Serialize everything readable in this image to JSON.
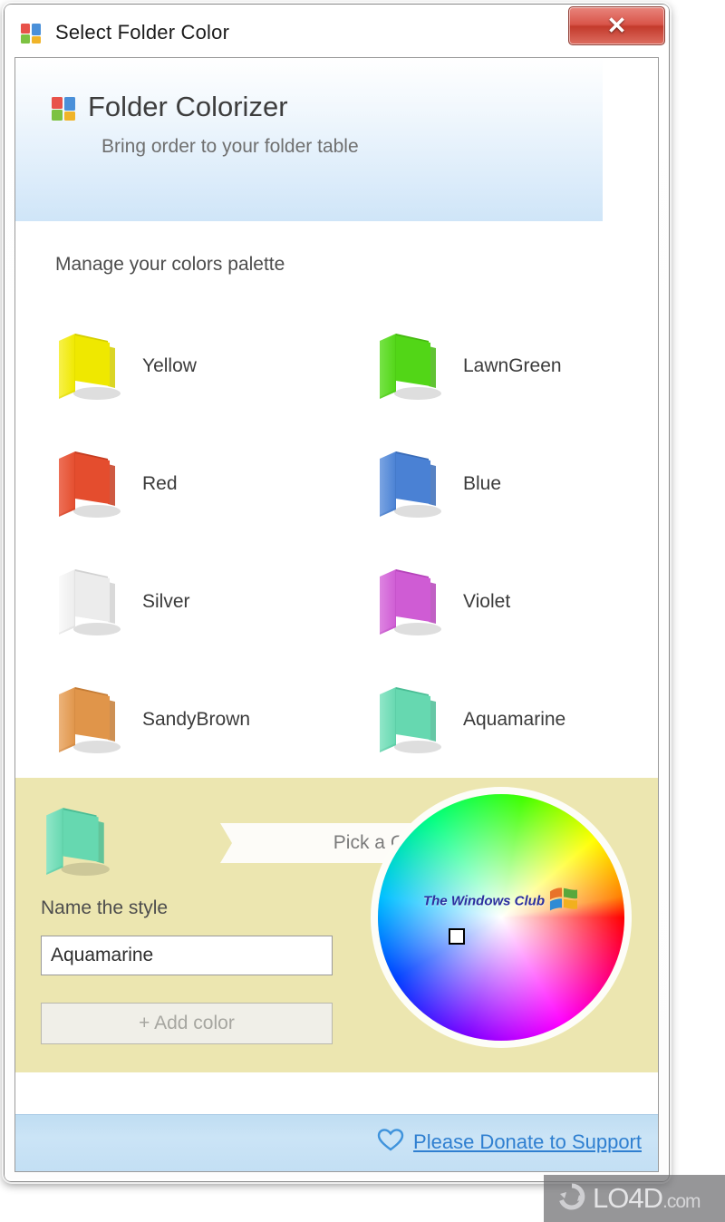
{
  "window": {
    "title": "Select Folder Color",
    "title_icon": "colored-folder-icon",
    "close_label": "✕"
  },
  "brand": {
    "logo_icon": "folder-colorizer-logo-icon",
    "title": "Folder Colorizer",
    "subtitle": "Bring order to your folder table"
  },
  "palette": {
    "heading": "Manage your colors palette",
    "items": [
      {
        "label": "Yellow",
        "color": "#efe800",
        "dark": "#d4ce00",
        "light": "#f7f14a"
      },
      {
        "label": "LawnGreen",
        "color": "#52d617",
        "dark": "#45b910",
        "light": "#76e346"
      },
      {
        "label": "Red",
        "color": "#e44d2e",
        "dark": "#c53d21",
        "light": "#ed7057"
      },
      {
        "label": "Blue",
        "color": "#4a81d4",
        "dark": "#3a6cb8",
        "light": "#7aa4e2"
      },
      {
        "label": "Silver",
        "color": "#ececec",
        "dark": "#d2d2d2",
        "light": "#fafafa"
      },
      {
        "label": "Violet",
        "color": "#cf5cd4",
        "dark": "#b544ba",
        "light": "#dd84e1"
      },
      {
        "label": "SandyBrown",
        "color": "#e0954a",
        "dark": "#c47c36",
        "light": "#ecb37a"
      },
      {
        "label": "Aquamarine",
        "color": "#66d8b0",
        "dark": "#4bbd95",
        "light": "#90e6c8"
      }
    ]
  },
  "editor": {
    "preview_color": "#66d8b0",
    "preview_dark": "#4bbd95",
    "preview_light": "#90e6c8",
    "pick_banner": "Pick a Color",
    "name_label": "Name the style",
    "name_value": "Aquamarine",
    "name_placeholder": "Name the style",
    "add_button": "+ Add color",
    "wheel_watermark": "The Windows Club",
    "wheel_watermark_icon": "windows-flag-icon",
    "wheel_cursor_icon": "color-picker-cursor"
  },
  "footer": {
    "donate_icon": "heart-icon",
    "donate_text": "Please Donate to Support"
  },
  "watermark": {
    "icon": "lo4d-refresh-icon",
    "name": "LO4D",
    "tld": ".com"
  },
  "colors": {
    "titlebar_text": "#1b1b1b",
    "close_button": "#d9554a",
    "brand_header": "#cfe5f8",
    "editor_panel": "#ece6b0",
    "footer": "#c3dff4",
    "link": "#2f7fd0"
  }
}
